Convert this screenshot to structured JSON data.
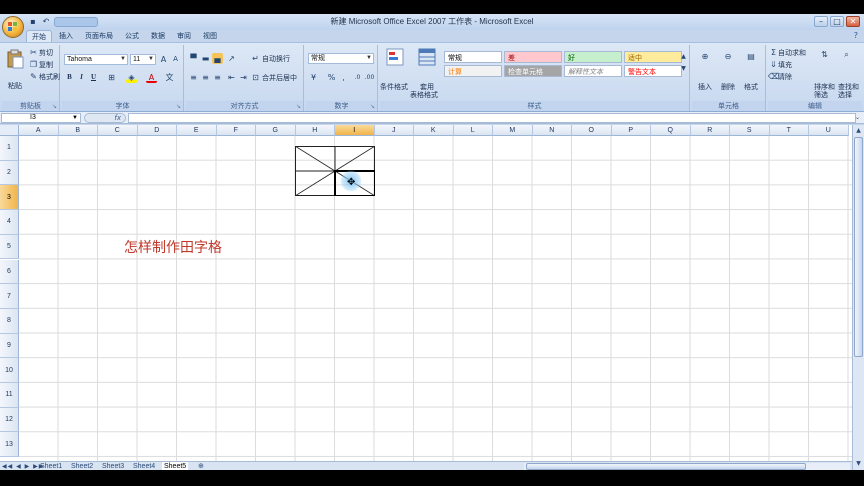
{
  "window": {
    "title": "新建 Microsoft Office Excel 2007 工作表 - Microsoft Excel",
    "controls": [
      "–",
      "□",
      "✕"
    ]
  },
  "tabs": [
    "开始",
    "插入",
    "页面布局",
    "公式",
    "数据",
    "审阅",
    "视图"
  ],
  "ribbon": {
    "clipboard": {
      "label": "剪贴板",
      "paste": "粘贴",
      "cut": "剪切",
      "copy": "复制",
      "format_painter": "格式刷"
    },
    "font": {
      "label": "字体",
      "name": "Tahoma",
      "size": "11",
      "bold": "B",
      "italic": "I",
      "underline": "U"
    },
    "alignment": {
      "label": "对齐方式",
      "wrap": "自动换行",
      "merge": "合并后居中"
    },
    "number": {
      "label": "数字",
      "format": "常规"
    },
    "styles": {
      "label": "样式",
      "conditional": "条件格式",
      "table_format": "套用",
      "table_format2": "表格格式",
      "cells": [
        {
          "text": "常规",
          "bg": "#ffffff",
          "fg": "#000000"
        },
        {
          "text": "差",
          "bg": "#ffc7ce",
          "fg": "#9c0006"
        },
        {
          "text": "好",
          "bg": "#c6efce",
          "fg": "#006100"
        },
        {
          "text": "适中",
          "bg": "#ffeb9c",
          "fg": "#9c6500"
        },
        {
          "text": "计算",
          "bg": "#f2f2f2",
          "fg": "#fa7d00"
        },
        {
          "text": "检查单元格",
          "bg": "#a5a5a5",
          "fg": "#ffffff"
        },
        {
          "text": "解释性文本",
          "bg": "#ffffff",
          "fg": "#7f7f7f"
        },
        {
          "text": "警告文本",
          "bg": "#ffffff",
          "fg": "#ff0000"
        }
      ]
    },
    "cells_group": {
      "label": "单元格",
      "insert": "插入",
      "delete": "删除",
      "format": "格式"
    },
    "editing": {
      "label": "编辑",
      "autosum": "自动求和",
      "fill": "填充",
      "clear": "清除",
      "sort": "排序和",
      "sort2": "筛选",
      "find": "查找和",
      "find2": "选择"
    }
  },
  "formula_bar": {
    "name_box": "I3",
    "fx": "fx",
    "content": ""
  },
  "columns": [
    "A",
    "B",
    "C",
    "D",
    "E",
    "F",
    "G",
    "H",
    "I",
    "J",
    "K",
    "L",
    "M",
    "N",
    "O",
    "P",
    "Q",
    "R",
    "S",
    "T",
    "U"
  ],
  "rows": [
    "1",
    "2",
    "3",
    "4",
    "5",
    "6",
    "7",
    "8",
    "9",
    "10",
    "11",
    "12",
    "13"
  ],
  "selected": {
    "column": "I",
    "row": "3"
  },
  "sheet_text": "怎样制作田字格",
  "sheets": [
    "Sheet1",
    "Sheet2",
    "Sheet3",
    "Sheet4",
    "Sheet5"
  ],
  "active_sheet": "Sheet5",
  "help": "?"
}
